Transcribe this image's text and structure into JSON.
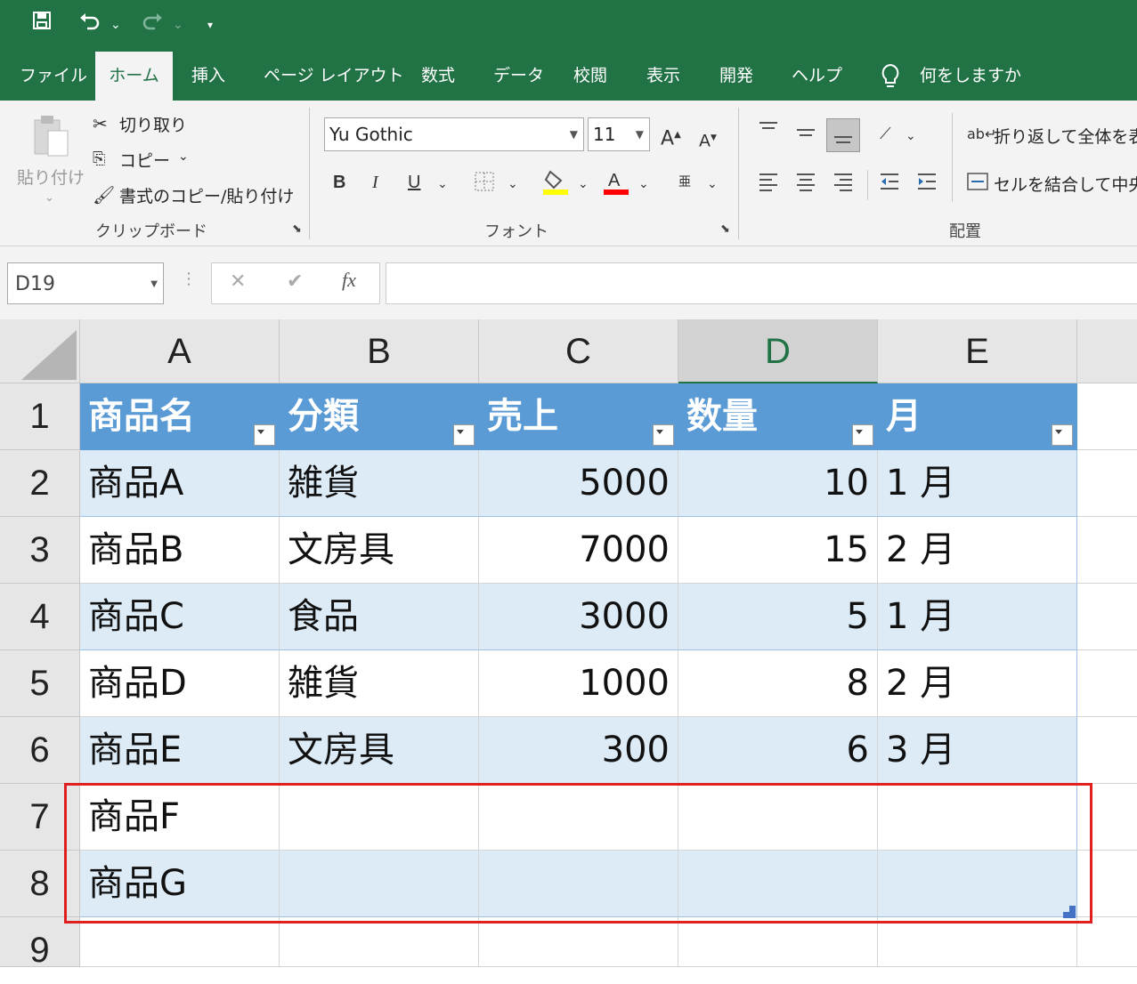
{
  "qat": {
    "save": "🖫",
    "undo": "↶",
    "redo": "↷",
    "more": "▾"
  },
  "tabs": [
    "ファイル",
    "ホーム",
    "挿入",
    "ページ レイアウト",
    "数式",
    "データ",
    "校閲",
    "表示",
    "開発",
    "ヘルプ"
  ],
  "active_tab": "ホーム",
  "tell_me": "何をしますか",
  "ribbon": {
    "clipboard": {
      "paste": "貼り付け",
      "cut": "切り取り",
      "copy": "コピー",
      "format_painter": "書式のコピー/貼り付け",
      "group": "クリップボード"
    },
    "font": {
      "name": "Yu Gothic",
      "size": "11",
      "bold": "B",
      "italic": "I",
      "underline": "U",
      "group": "フォント"
    },
    "alignment": {
      "wrap_text": "折り返して全体を表",
      "merge": "セルを結合して中央",
      "group": "配置"
    },
    "colors": {
      "highlight": "#ffff00",
      "font_color": "#ff0000"
    }
  },
  "formula_bar": {
    "name_box": "D19",
    "cancel": "✕",
    "enter": "✔",
    "fx": "fx",
    "value": ""
  },
  "sheet": {
    "columns": [
      "A",
      "B",
      "C",
      "D",
      "E"
    ],
    "selected_column": "D",
    "rows": [
      "1",
      "2",
      "3",
      "4",
      "5",
      "6",
      "7",
      "8",
      "9"
    ],
    "header": [
      "商品名",
      "分類",
      "売上",
      "数量",
      "月"
    ],
    "data": [
      [
        "商品A",
        "雑貨",
        "5000",
        "10",
        "1 月"
      ],
      [
        "商品B",
        "文房具",
        "7000",
        "15",
        "2 月"
      ],
      [
        "商品C",
        "食品",
        "3000",
        "5",
        "1 月"
      ],
      [
        "商品D",
        "雑貨",
        "1000",
        "8",
        "2 月"
      ],
      [
        "商品E",
        "文房具",
        "300",
        "6",
        "3 月"
      ],
      [
        "商品F",
        "",
        "",
        "",
        ""
      ],
      [
        "商品G",
        "",
        "",
        "",
        ""
      ]
    ]
  },
  "colors": {
    "accent": "#217346",
    "table_header": "#5b9bd5",
    "table_band": "#ddebf7",
    "highlight_box": "#e02020"
  }
}
